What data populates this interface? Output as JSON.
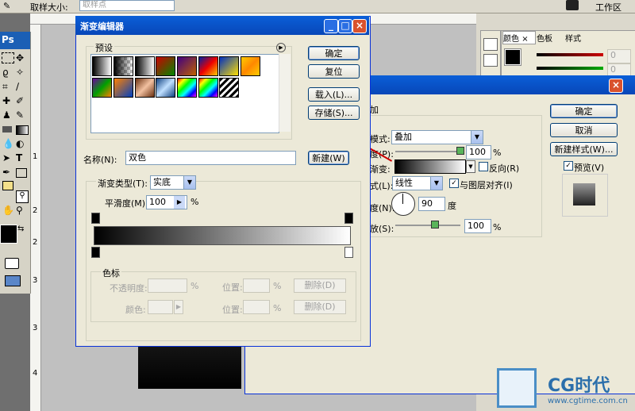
{
  "app_bar": {
    "sample_size_label": "取样大小:",
    "sample_point_value": "取样点",
    "workspace_label": "工作区"
  },
  "toolbox": {
    "logo": "Ps"
  },
  "color_panel": {
    "tabs": [
      "颜色",
      "色板",
      "样式"
    ],
    "close_mark": "×",
    "value_placeholder": "0"
  },
  "gradient_editor": {
    "title": "渐变编辑器",
    "presets_label": "预设",
    "buttons": {
      "ok": "确定",
      "reset": "复位",
      "load": "载入(L)...",
      "save": "存储(S)...",
      "new": "新建(W)"
    },
    "name_label": "名称(N):",
    "name_value": "双色",
    "gradient_type_label": "渐变类型(T):",
    "gradient_type_value": "实底",
    "smoothness_label": "平滑度(M):",
    "smoothness_value": "100",
    "percent": "%",
    "stops_label": "色标",
    "opacity_label": "不透明度:",
    "color_label": "颜色:",
    "location_label": "位置:",
    "delete_label": "删除(D)"
  },
  "layer_style": {
    "buttons": {
      "ok": "确定",
      "cancel": "取消",
      "new_style": "新建样式(W)..."
    },
    "preview_label": "预览(V)",
    "group_hint": "加",
    "blend_mode_label": "模式:",
    "blend_mode_value": "叠加",
    "opacity_label": "度(P):",
    "opacity_value": "100",
    "gradient_label": "渐变:",
    "reverse_label": "反向(R)",
    "style_label": "式(L):",
    "style_value": "线性",
    "align_label": "与图层对齐(I)",
    "angle_label": "度(N):",
    "angle_value": "90",
    "angle_unit": "度",
    "scale_label": "放(S):",
    "scale_value": "100",
    "percent": "%"
  },
  "ruler": {
    "marks": [
      "1",
      "2",
      "2",
      "3",
      "3",
      "4"
    ]
  },
  "watermark": {
    "brand": "CG时代",
    "url": "www.cgtime.com.cn"
  }
}
